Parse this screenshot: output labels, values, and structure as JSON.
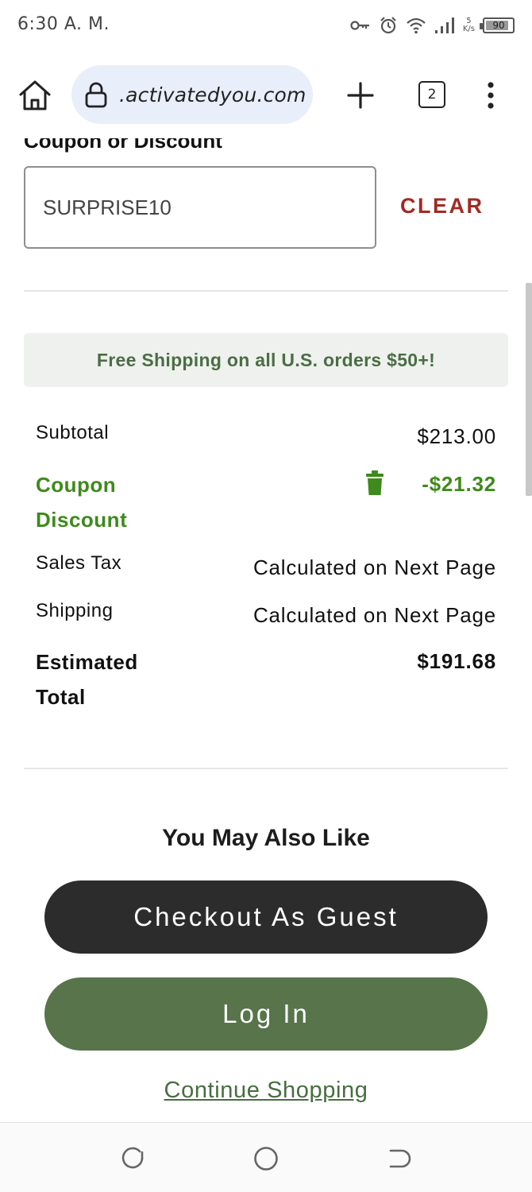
{
  "status_bar": {
    "time": "6:30 A. M.",
    "battery": "90",
    "battery_level": 0.9,
    "speed_value": "5",
    "speed_unit": "K/s"
  },
  "browser": {
    "url": ".activatedyou.com",
    "tab_count": "2"
  },
  "coupon": {
    "section_title": "Coupon or Discount",
    "code": "SURPRISE10",
    "clear_label": "CLEAR"
  },
  "shipping_banner": "Free Shipping on all U.S. orders $50+!",
  "summary": {
    "subtotal_label": "Subtotal",
    "subtotal_value": "$213.00",
    "discount_label": "Coupon Discount",
    "discount_value": "-$21.32",
    "tax_label": "Sales Tax",
    "tax_value": "Calculated on Next Page",
    "shipping_label": "Shipping",
    "shipping_value": "Calculated on Next Page",
    "total_label": "Estimated Total",
    "total_value": "$191.68"
  },
  "also_like_title": "You May Also Like",
  "actions": {
    "guest_label": "Checkout As Guest",
    "login_label": "Log In",
    "continue_label": "Continue Shopping"
  },
  "colors": {
    "clear": "#a22a22",
    "discount_green": "#3e8a1c",
    "banner_text": "#4a6e44",
    "guest_button": "#2c2c2c",
    "login_button": "#57744b"
  }
}
